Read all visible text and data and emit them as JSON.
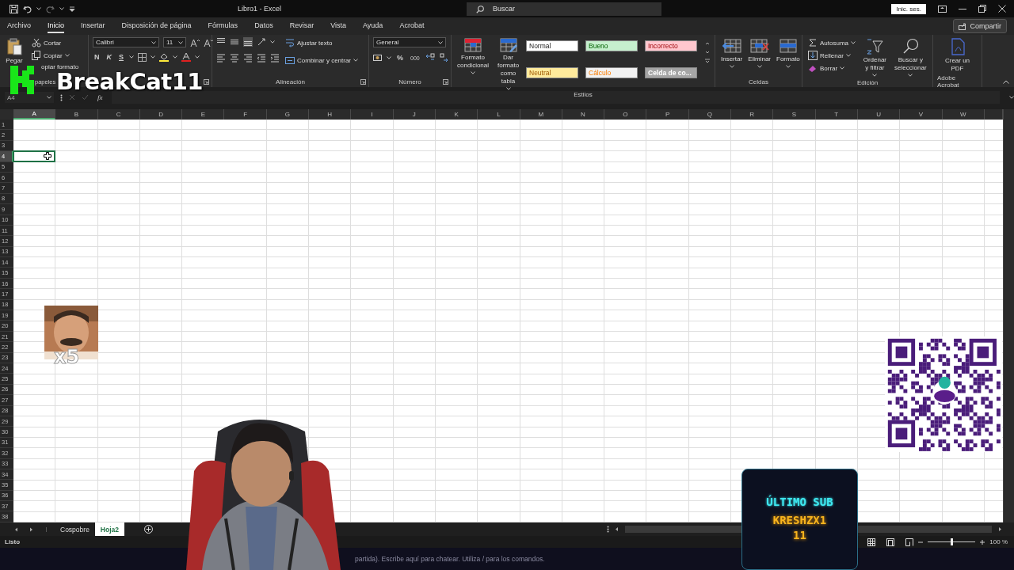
{
  "title_bar": {
    "title": "Libro1 - Excel",
    "search": {
      "placeholder": "Buscar"
    },
    "sign_in": "Inic. ses."
  },
  "menu_tabs": [
    {
      "label": "Archivo",
      "selected": false
    },
    {
      "label": "Inicio",
      "selected": true
    },
    {
      "label": "Insertar",
      "selected": false
    },
    {
      "label": "Disposición de página",
      "selected": false
    },
    {
      "label": "Fórmulas",
      "selected": false
    },
    {
      "label": "Datos",
      "selected": false
    },
    {
      "label": "Revisar",
      "selected": false
    },
    {
      "label": "Vista",
      "selected": false
    },
    {
      "label": "Ayuda",
      "selected": false
    },
    {
      "label": "Acrobat",
      "selected": false
    }
  ],
  "share": "Compartir",
  "ribbon": {
    "clipboard": {
      "paste": "Pegar",
      "cut": "Cortar",
      "copy": "Copiar",
      "format_painter": "opiar formato",
      "label": "papeles"
    },
    "font": {
      "name": "Calibri",
      "size": "11",
      "bold": "N",
      "italic": "K",
      "underline": "S"
    },
    "alignment": {
      "wrap": "Ajustar texto",
      "merge": "Combinar y centrar",
      "label": "Alineación"
    },
    "number": {
      "format": "General",
      "percent": "%",
      "thousands": "000",
      "label": "Número"
    },
    "styles": {
      "conditional": "Formato condicional",
      "as_table": "Dar formato como tabla",
      "cell_styles": [
        {
          "label": "Normal",
          "kind": "normal"
        },
        {
          "label": "Bueno",
          "kind": "good"
        },
        {
          "label": "Incorrecto",
          "kind": "bad"
        },
        {
          "label": "Neutral",
          "kind": "neutral"
        },
        {
          "label": "Cálculo",
          "kind": "calculation"
        },
        {
          "label": "Celda de co...",
          "kind": "check"
        }
      ],
      "label": "Estilos"
    },
    "cells": {
      "buttons": [
        "Insertar",
        "Eliminar",
        "Formato"
      ],
      "label": "Celdas"
    },
    "editing": {
      "autosum": "Autosuma",
      "fill": "Rellenar",
      "clear": "Borrar",
      "sort": "Ordenar y filtrar",
      "find": "Buscar y seleccionar",
      "label": "Edición"
    },
    "acrobat": {
      "create_pdf": "Crear un PDF",
      "label": "Adobe Acrobat"
    }
  },
  "formula_bar": {
    "name_box": "A4",
    "function_label": "fx"
  },
  "sheet": {
    "columns": [
      {
        "label": "A",
        "selected": true
      },
      {
        "label": "B",
        "selected": false
      },
      {
        "label": "C",
        "selected": false
      },
      {
        "label": "D",
        "selected": false
      },
      {
        "label": "E",
        "selected": false
      },
      {
        "label": "F",
        "selected": false
      },
      {
        "label": "G",
        "selected": false
      },
      {
        "label": "H",
        "selected": false
      },
      {
        "label": "I",
        "selected": false
      },
      {
        "label": "J",
        "selected": false
      },
      {
        "label": "K",
        "selected": false
      },
      {
        "label": "L",
        "selected": false
      },
      {
        "label": "M",
        "selected": false
      },
      {
        "label": "N",
        "selected": false
      },
      {
        "label": "O",
        "selected": false
      },
      {
        "label": "P",
        "selected": false
      },
      {
        "label": "Q",
        "selected": false
      },
      {
        "label": "R",
        "selected": false
      },
      {
        "label": "S",
        "selected": false
      },
      {
        "label": "T",
        "selected": false
      },
      {
        "label": "U",
        "selected": false
      },
      {
        "label": "V",
        "selected": false
      },
      {
        "label": "W",
        "selected": false
      }
    ],
    "rows": [
      {
        "label": "1",
        "selected": false
      },
      {
        "label": "2",
        "selected": false
      },
      {
        "label": "3",
        "selected": false
      },
      {
        "label": "4",
        "selected": true
      },
      {
        "label": "5",
        "selected": false
      },
      {
        "label": "6",
        "selected": false
      },
      {
        "label": "7",
        "selected": false
      },
      {
        "label": "8",
        "selected": false
      },
      {
        "label": "9",
        "selected": false
      },
      {
        "label": "10",
        "selected": false
      },
      {
        "label": "11",
        "selected": false
      },
      {
        "label": "12",
        "selected": false
      },
      {
        "label": "13",
        "selected": false
      },
      {
        "label": "14",
        "selected": false
      },
      {
        "label": "15",
        "selected": false
      },
      {
        "label": "16",
        "selected": false
      },
      {
        "label": "17",
        "selected": false
      },
      {
        "label": "18",
        "selected": false
      },
      {
        "label": "19",
        "selected": false
      },
      {
        "label": "20",
        "selected": false
      },
      {
        "label": "21",
        "selected": false
      },
      {
        "label": "22",
        "selected": false
      },
      {
        "label": "23",
        "selected": false
      },
      {
        "label": "24",
        "selected": false
      },
      {
        "label": "25",
        "selected": false
      },
      {
        "label": "26",
        "selected": false
      },
      {
        "label": "27",
        "selected": false
      },
      {
        "label": "28",
        "selected": false
      },
      {
        "label": "29",
        "selected": false
      },
      {
        "label": "30",
        "selected": false
      },
      {
        "label": "31",
        "selected": false
      },
      {
        "label": "32",
        "selected": false
      },
      {
        "label": "33",
        "selected": false
      },
      {
        "label": "34",
        "selected": false
      },
      {
        "label": "35",
        "selected": false
      },
      {
        "label": "36",
        "selected": false
      },
      {
        "label": "37",
        "selected": false
      },
      {
        "label": "38",
        "selected": false
      }
    ]
  },
  "sheet_tabs": [
    {
      "label": "Cospobre",
      "selected": false
    },
    {
      "label": "Hoja2",
      "selected": true
    }
  ],
  "status_bar": {
    "status": "Listo",
    "zoom": {
      "level": 0.5
    },
    "zoom_label": "100 %"
  },
  "chat": {
    "placeholder": "partida). Escribe aquí para chatear. Utiliza / para los comandos."
  },
  "overlays": {
    "channel_name": "BreakCat11",
    "emote_count": "x5",
    "sub_alert": {
      "title": "ÚLTIMO SUB",
      "name": "KRESHZX111"
    }
  }
}
